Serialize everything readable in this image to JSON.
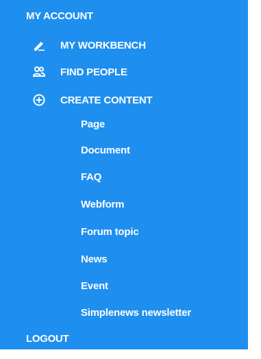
{
  "colors": {
    "panel_background": "#1e8fef",
    "text": "#ffffff"
  },
  "menu": {
    "my_account": "MY ACCOUNT",
    "items": [
      {
        "label": "MY WORKBENCH",
        "icon": "pencil-icon"
      },
      {
        "label": "FIND PEOPLE",
        "icon": "people-icon"
      },
      {
        "label": "CREATE CONTENT",
        "icon": "plus-circle-icon"
      }
    ],
    "create_content_subitems": [
      "Page",
      "Document",
      "FAQ",
      "Webform",
      "Forum topic",
      "News",
      "Event",
      "Simplenews newsletter"
    ],
    "logout": "LOGOUT"
  }
}
